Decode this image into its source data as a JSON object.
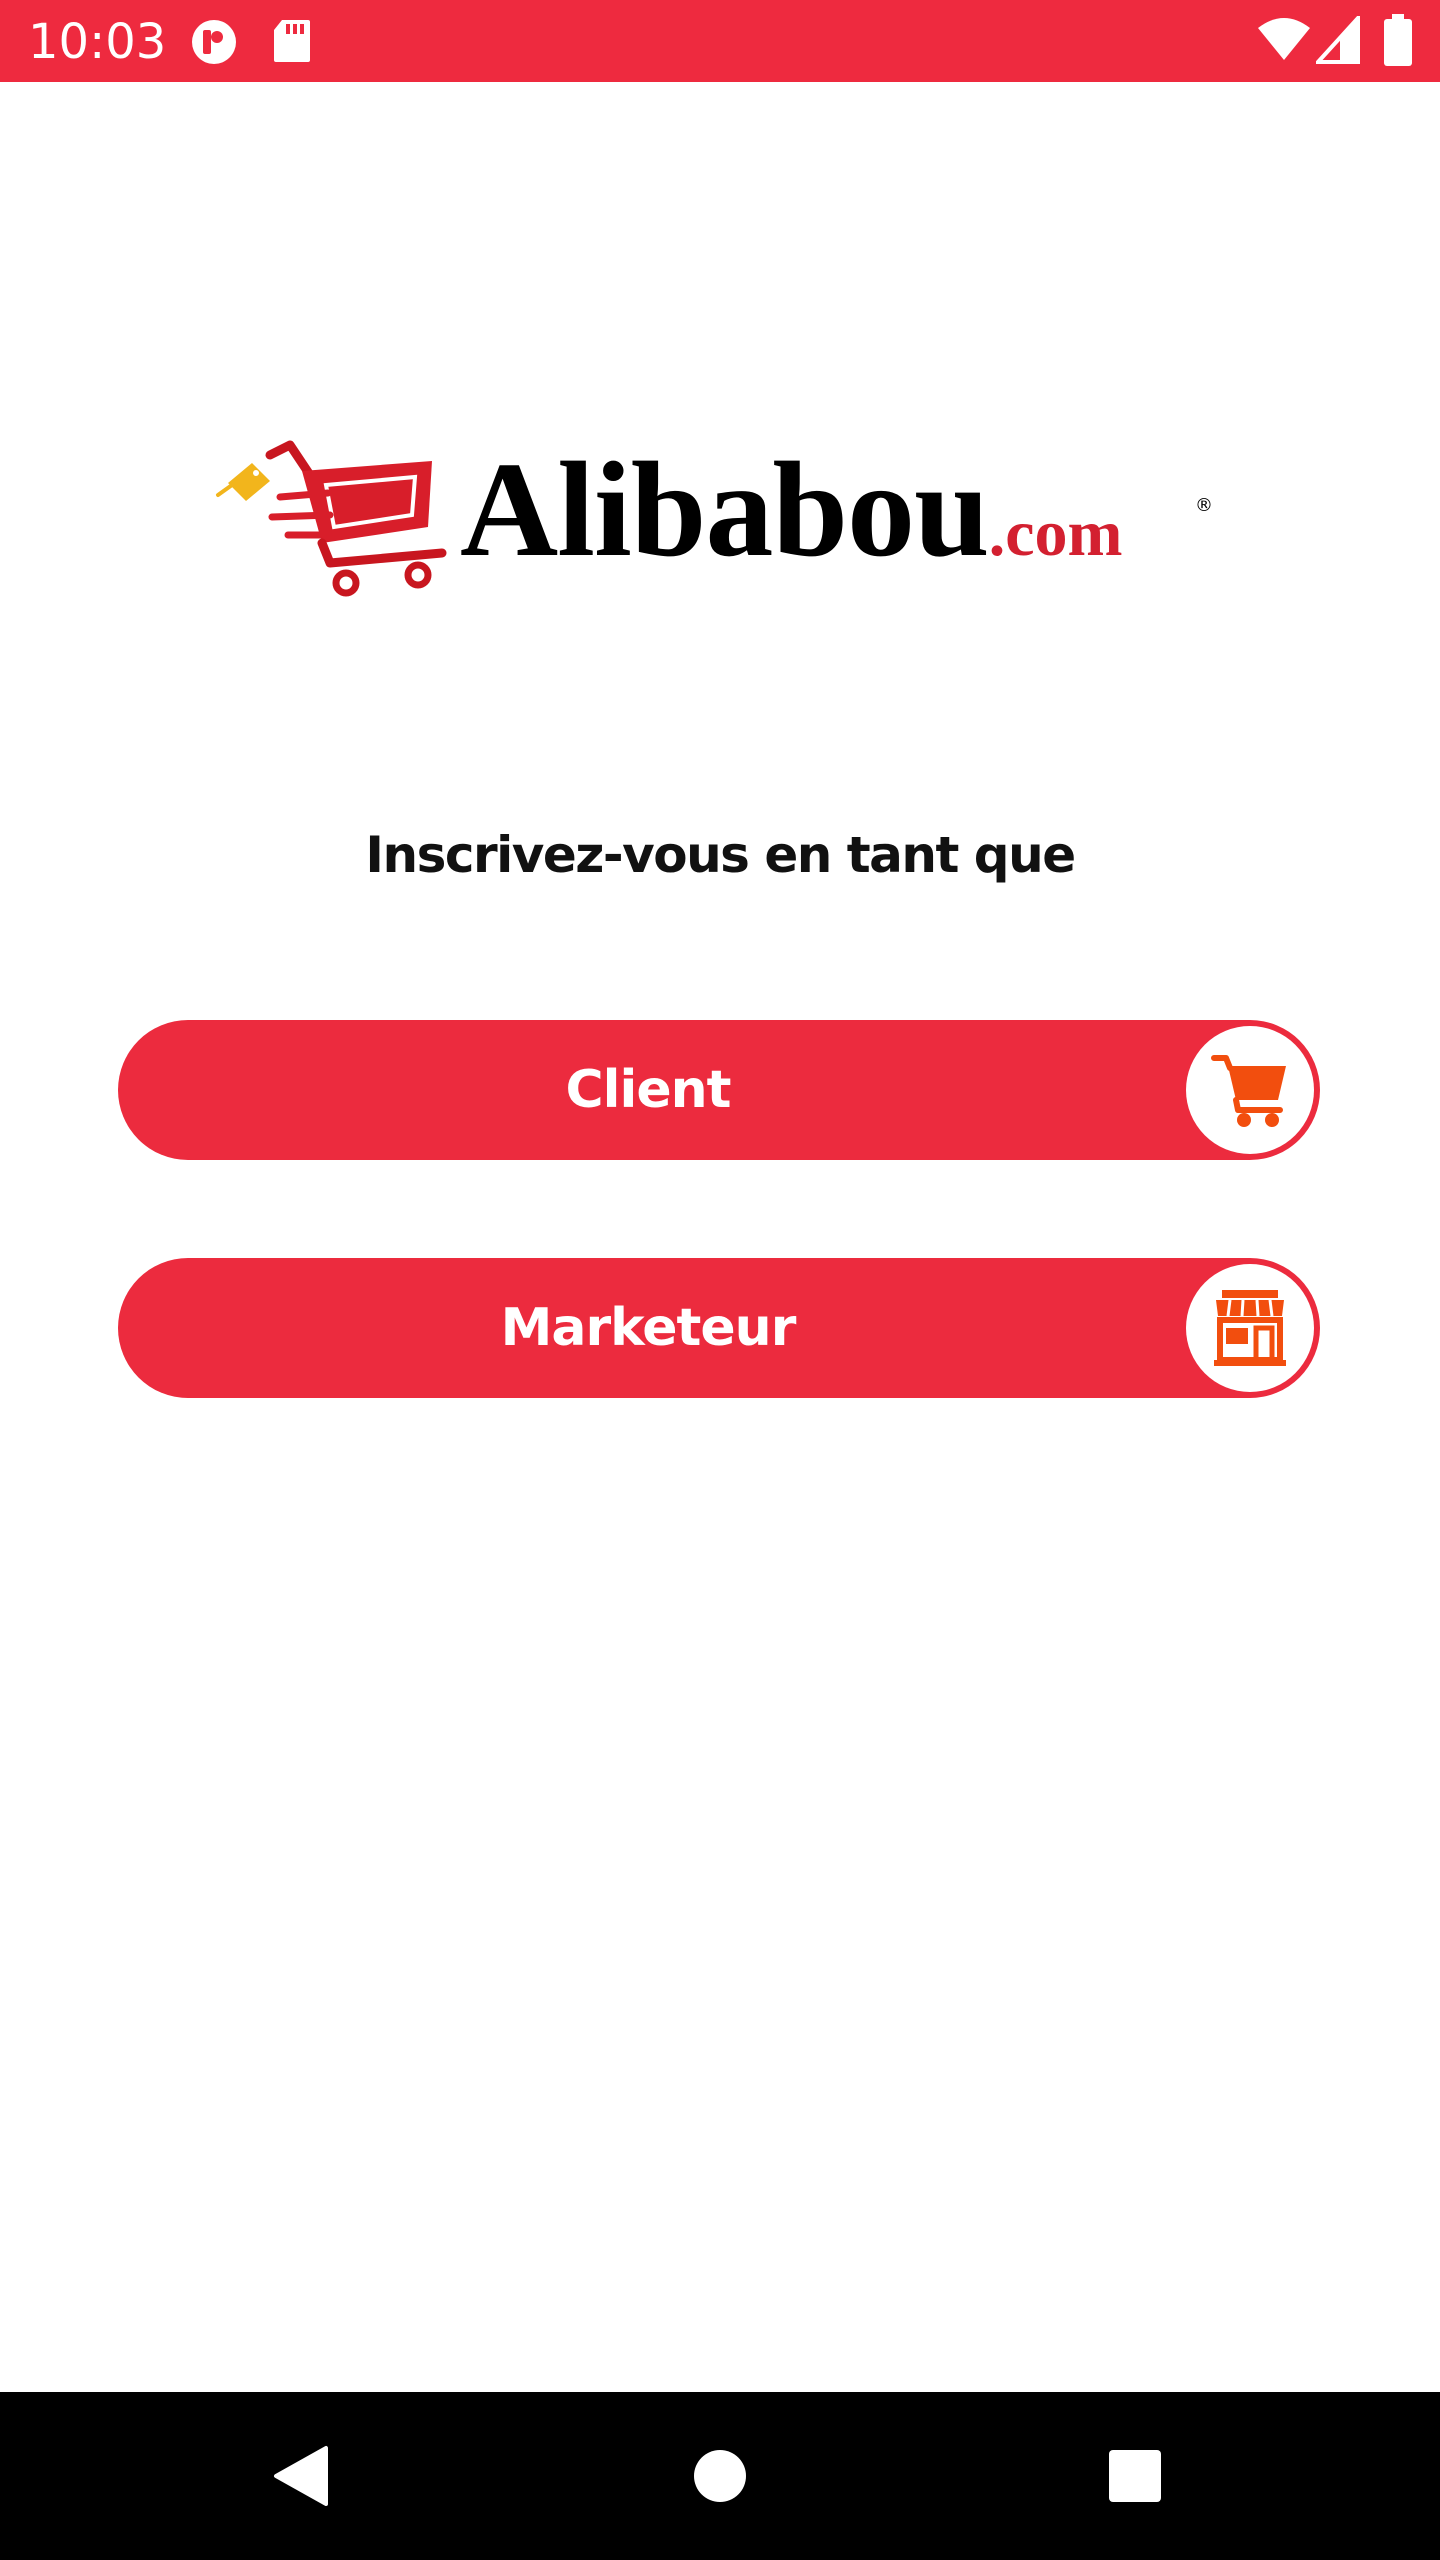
{
  "status_bar": {
    "time": "10:03",
    "background_color": "#ee2a3f",
    "icons": [
      "app-notification-icon",
      "sd-card-icon",
      "wifi-icon",
      "cell-signal-icon",
      "battery-icon"
    ]
  },
  "logo": {
    "brand": "Alibabou",
    "tld": ".com",
    "registered_mark": "®"
  },
  "heading": "Inscrivez-vous en tant que",
  "roles": [
    {
      "label": "Client",
      "icon": "shopping-cart-icon"
    },
    {
      "label": "Marketeur",
      "icon": "storefront-icon"
    }
  ],
  "colors": {
    "accent": "#ec2b3e",
    "icon_orange": "#f24e0e"
  },
  "nav_bar": {
    "buttons": [
      "back-icon",
      "home-icon",
      "recents-icon"
    ]
  }
}
